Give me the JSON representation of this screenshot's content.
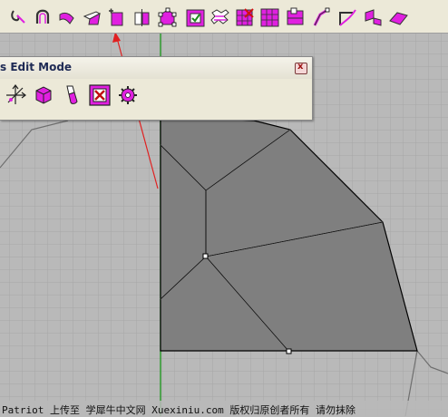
{
  "panel": {
    "title": "s Edit Mode",
    "close_glyph": "x"
  },
  "toolbar": {
    "icons": [
      "curve-hook-icon",
      "u-curve-icon",
      "extrude-curve-icon",
      "bend-surface-icon",
      "new-point-icon",
      "split-box-icon",
      "control-points-icon",
      "check-box-icon",
      "sweep-icon",
      "delete-points-icon",
      "grid-surface-icon",
      "layer-box-icon",
      "move-curve-icon",
      "edit-corner-icon",
      "fold-surface-icon",
      "flat-patch-icon"
    ]
  },
  "edit_tools": {
    "icons": [
      "axis-transform-icon",
      "cube-edit-icon",
      "paint-tool-icon",
      "delete-tool-icon",
      "gear-tool-icon"
    ]
  },
  "watermark": {
    "text": "Patriot 上传至 学犀牛中文网 Xuexiniu.com 版权归原创者所有 请勿抹除"
  },
  "colors": {
    "viewport_bg": "#b9b9b9",
    "grid_line": "#a5a5a5",
    "surface_fill": "#7f7f7f",
    "edge": "#000000",
    "mesh_line": "#ffffff",
    "y_axis": "#2e9a2e",
    "annotation_arrow": "#e02020",
    "toolbar_bg": "#ece9d8",
    "icon_accent": "#e020e0"
  }
}
